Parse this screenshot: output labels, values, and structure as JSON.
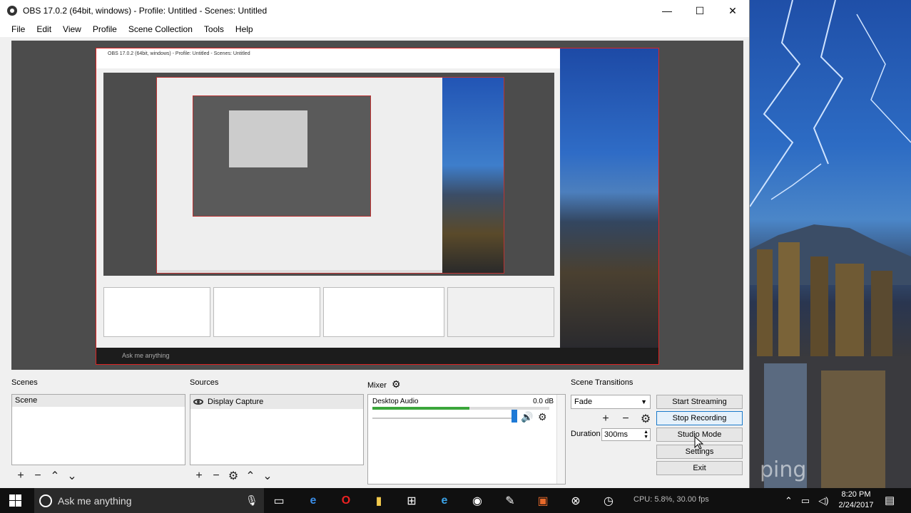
{
  "window": {
    "title": "OBS 17.0.2 (64bit, windows) - Profile: Untitled - Scenes: Untitled",
    "minimize": "—",
    "maximize": "☐",
    "close": "✕"
  },
  "menu": [
    "File",
    "Edit",
    "View",
    "Profile",
    "Scene Collection",
    "Tools",
    "Help"
  ],
  "preview": {
    "nested_title": "OBS 17.0.2 (64bit, windows) - Profile: Untitled - Scenes: Untitled",
    "nested_search": "Ask me anything"
  },
  "scenes": {
    "label": "Scenes",
    "items": [
      "Scene"
    ]
  },
  "sources": {
    "label": "Sources",
    "items": [
      "Display Capture"
    ]
  },
  "mixer": {
    "label": "Mixer",
    "channel": "Desktop Audio",
    "db": "0.0 dB",
    "level": 0.55
  },
  "transitions": {
    "label": "Scene Transitions",
    "selected": "Fade",
    "duration_label": "Duration",
    "duration_value": "300ms"
  },
  "controls": {
    "start_streaming": "Start Streaming",
    "stop_recording": "Stop Recording",
    "studio_mode": "Studio Mode",
    "settings": "Settings",
    "exit": "Exit"
  },
  "taskbar": {
    "search_placeholder": "Ask me anything",
    "cpu": "CPU: 5.8%, 30.00 fps",
    "time": "8:20 PM",
    "date": "2/24/2017"
  },
  "wallpaper_text": "ping",
  "colors": {
    "accent": "#1f7ad6",
    "preview_bg": "#4c4c4c",
    "capture_border": "#dd2222",
    "taskbar": "#101010"
  },
  "icons": [
    "obs-icon",
    "gear-icon",
    "eye-icon",
    "speaker-icon",
    "plus-icon",
    "minus-icon",
    "up-icon",
    "down-icon",
    "windows-start-icon",
    "cortana-icon",
    "mic-icon",
    "task-view-icon",
    "edge-icon",
    "opera-icon",
    "file-explorer-icon",
    "store-icon",
    "ie-icon",
    "obs-taskbar-icon",
    "xbox-icon",
    "clock-icon"
  ]
}
